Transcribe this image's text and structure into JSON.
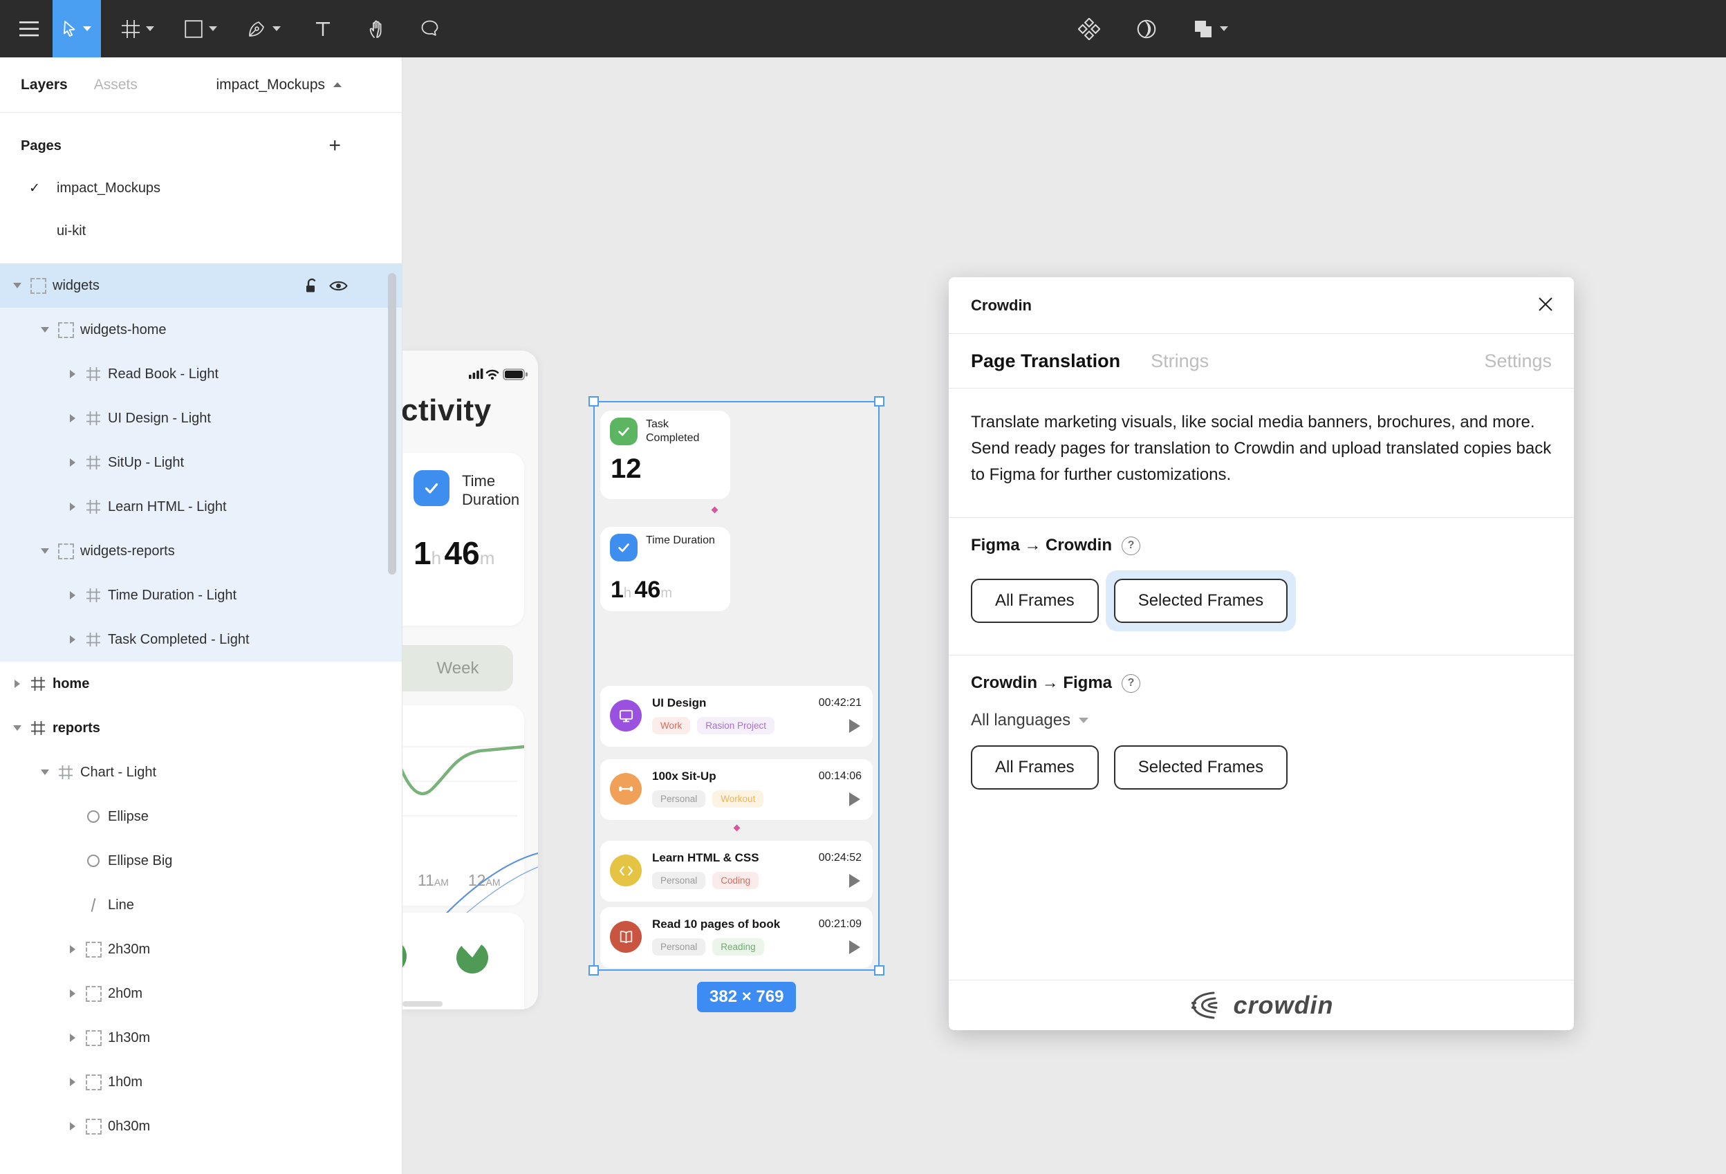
{
  "colors": {
    "toolbar_bg": "#2c2c2c",
    "tool_selected": "#4a9ff2",
    "selection_blue": "#4d9ef1",
    "badge_blue": "#3c8cf3",
    "sidebar_selected_row": "#d3e7f8",
    "sidebar_tint_rows": "#e9f2fb",
    "canvas_bg": "#eaeaeb"
  },
  "sidebar": {
    "tabs": {
      "layers": "Layers",
      "assets": "Assets"
    },
    "file_menu": "impact_Mockups",
    "pages": {
      "title": "Pages",
      "items": [
        {
          "label": "impact_Mockups",
          "active": true
        },
        {
          "label": "ui-kit",
          "active": false
        }
      ]
    },
    "tree": [
      {
        "label": "widgets",
        "type": "group",
        "depth": 0,
        "caret": "exp",
        "selected": true
      },
      {
        "label": "widgets-home",
        "type": "group",
        "depth": 1,
        "caret": "exp",
        "tint": true
      },
      {
        "label": "Read Book - Light",
        "type": "frame",
        "depth": 2,
        "caret": "col",
        "tint": true
      },
      {
        "label": "UI Design - Light",
        "type": "frame",
        "depth": 2,
        "caret": "col",
        "tint": true
      },
      {
        "label": "SitUp - Light",
        "type": "frame",
        "depth": 2,
        "caret": "col",
        "tint": true
      },
      {
        "label": "Learn HTML - Light",
        "type": "frame",
        "depth": 2,
        "caret": "col",
        "tint": true
      },
      {
        "label": "widgets-reports",
        "type": "group",
        "depth": 1,
        "caret": "exp",
        "tint": true
      },
      {
        "label": "Time Duration - Light",
        "type": "frame",
        "depth": 2,
        "caret": "col",
        "tint": true
      },
      {
        "label": "Task Completed - Light",
        "type": "frame",
        "depth": 2,
        "caret": "col",
        "tint": true
      },
      {
        "label": "home",
        "type": "frame",
        "depth": 0,
        "caret": "col",
        "bold": true
      },
      {
        "label": "reports",
        "type": "frame",
        "depth": 0,
        "caret": "exp",
        "bold": true
      },
      {
        "label": "Chart - Light",
        "type": "frame",
        "depth": 1,
        "caret": "exp"
      },
      {
        "label": "Ellipse",
        "type": "ellipse",
        "depth": 2,
        "caret": "none"
      },
      {
        "label": "Ellipse Big",
        "type": "ellipse",
        "depth": 2,
        "caret": "none"
      },
      {
        "label": "Line",
        "type": "line",
        "depth": 2,
        "caret": "none"
      },
      {
        "label": "2h30m",
        "type": "group",
        "depth": 2,
        "caret": "col"
      },
      {
        "label": "2h0m",
        "type": "group",
        "depth": 2,
        "caret": "col"
      },
      {
        "label": "1h30m",
        "type": "group",
        "depth": 2,
        "caret": "col"
      },
      {
        "label": "1h0m",
        "type": "group",
        "depth": 2,
        "caret": "col"
      },
      {
        "label": "0h30m",
        "type": "group",
        "depth": 2,
        "caret": "col"
      }
    ]
  },
  "canvas": {
    "phone": {
      "heading": "ctivity",
      "time_card": {
        "title": "Time Duration",
        "hours": "1",
        "hours_unit": "h",
        "minutes": "46",
        "minutes_unit": "m",
        "icon_color": "#3e8ef0"
      },
      "week_pill": "Week",
      "x_labels": [
        {
          "num": "11",
          "suffix": "AM"
        },
        {
          "num": "12",
          "suffix": "AM"
        }
      ]
    },
    "frame": {
      "widget_a": {
        "title": "Task Completed",
        "value": "12",
        "icon_color": "#5cb661"
      },
      "widget_b": {
        "title": "Time Duration",
        "hours": "1",
        "hours_unit": "h",
        "minutes": "46",
        "minutes_unit": "m",
        "icon_color": "#3e8ef0"
      },
      "tasks": [
        {
          "name": "UI Design",
          "time": "00:42:21",
          "icon": "monitor",
          "icon_color": "#9b51e0",
          "tags": [
            {
              "label": "Work",
              "bg": "#fcedea",
              "fg": "#df6a5a"
            },
            {
              "label": "Rasion Project",
              "bg": "#f5eefb",
              "fg": "#a96fd8"
            }
          ]
        },
        {
          "name": "100x Sit-Up",
          "time": "00:14:06",
          "icon": "dumbbell",
          "icon_color": "#f0a057",
          "tags": [
            {
              "label": "Personal",
              "bg": "#efefef",
              "fg": "#9a9a9a"
            },
            {
              "label": "Workout",
              "bg": "#fcf3e3",
              "fg": "#efb35c"
            }
          ]
        },
        {
          "name": "Learn HTML & CSS",
          "time": "00:24:52",
          "icon": "code",
          "icon_color": "#e5c343",
          "tags": [
            {
              "label": "Personal",
              "bg": "#efefef",
              "fg": "#9a9a9a"
            },
            {
              "label": "Coding",
              "bg": "#fbebea",
              "fg": "#df6a5a"
            }
          ]
        },
        {
          "name": "Read 10 pages of book",
          "time": "00:21:09",
          "icon": "book",
          "icon_color": "#c9543f",
          "tags": [
            {
              "label": "Personal",
              "bg": "#efefef",
              "fg": "#9a9a9a"
            },
            {
              "label": "Reading",
              "bg": "#ebf5ea",
              "fg": "#6cae70"
            }
          ]
        }
      ],
      "dimension_badge": "382 × 769"
    }
  },
  "modal": {
    "title": "Crowdin",
    "tabs": [
      {
        "label": "Page Translation",
        "active": true
      },
      {
        "label": "Strings",
        "active": false
      },
      {
        "label": "Settings",
        "active": false
      }
    ],
    "description": "Translate marketing visuals, like social media banners, brochures, and more. Send ready pages for translation to Crowdin and upload translated copies back to Figma for further customizations.",
    "figma_to_crowdin": {
      "title": "Figma → Crowdin",
      "all_frames": "All Frames",
      "selected_frames": "Selected Frames"
    },
    "crowdin_to_figma": {
      "title": "Crowdin → Figma",
      "dropdown": "All languages",
      "all_frames": "All Frames",
      "selected_frames": "Selected Frames"
    },
    "logo_text": "crowdin"
  }
}
